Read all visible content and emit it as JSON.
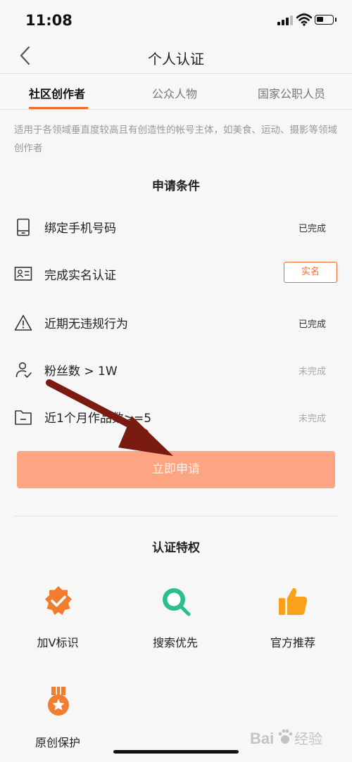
{
  "status_bar": {
    "time": "11:08"
  },
  "nav": {
    "title": "个人认证"
  },
  "tabs": [
    {
      "label": "社区创作者",
      "active": true
    },
    {
      "label": "公众人物",
      "active": false
    },
    {
      "label": "国家公职人员",
      "active": false
    }
  ],
  "description": "适用于各领域垂直度较高且有创造性的帐号主体，如美食、运动、摄影等领域创作者",
  "conditions": {
    "title": "申请条件",
    "items": [
      {
        "icon": "phone-icon",
        "label": "绑定手机号码",
        "status": "已完成"
      },
      {
        "icon": "id-card-icon",
        "label": "完成实名认证",
        "action": "实名"
      },
      {
        "icon": "warning-icon",
        "label": "近期无违规行为",
        "status": "已完成"
      },
      {
        "icon": "follower-icon",
        "label": "粉丝数 > 1W",
        "status": "未完成"
      },
      {
        "icon": "folder-icon",
        "label": "近1个月作品数>=5",
        "status": "未完成"
      }
    ]
  },
  "apply_button": {
    "label": "立即申请"
  },
  "privileges": {
    "title": "认证特权",
    "items": [
      {
        "icon": "verified-badge-icon",
        "label": "加V标识"
      },
      {
        "icon": "search-icon",
        "label": "搜索优先"
      },
      {
        "icon": "thumbs-up-icon",
        "label": "官方推荐"
      },
      {
        "icon": "medal-icon",
        "label": "原创保护"
      }
    ]
  },
  "colors": {
    "accent": "#f06a2c",
    "apply_button": "#fda582",
    "search_icon": "#2bbf8f",
    "annotation_arrow": "#7a1a10"
  },
  "watermark": {
    "text": "Bai 经验",
    "icon": "baidu-paw-icon"
  }
}
